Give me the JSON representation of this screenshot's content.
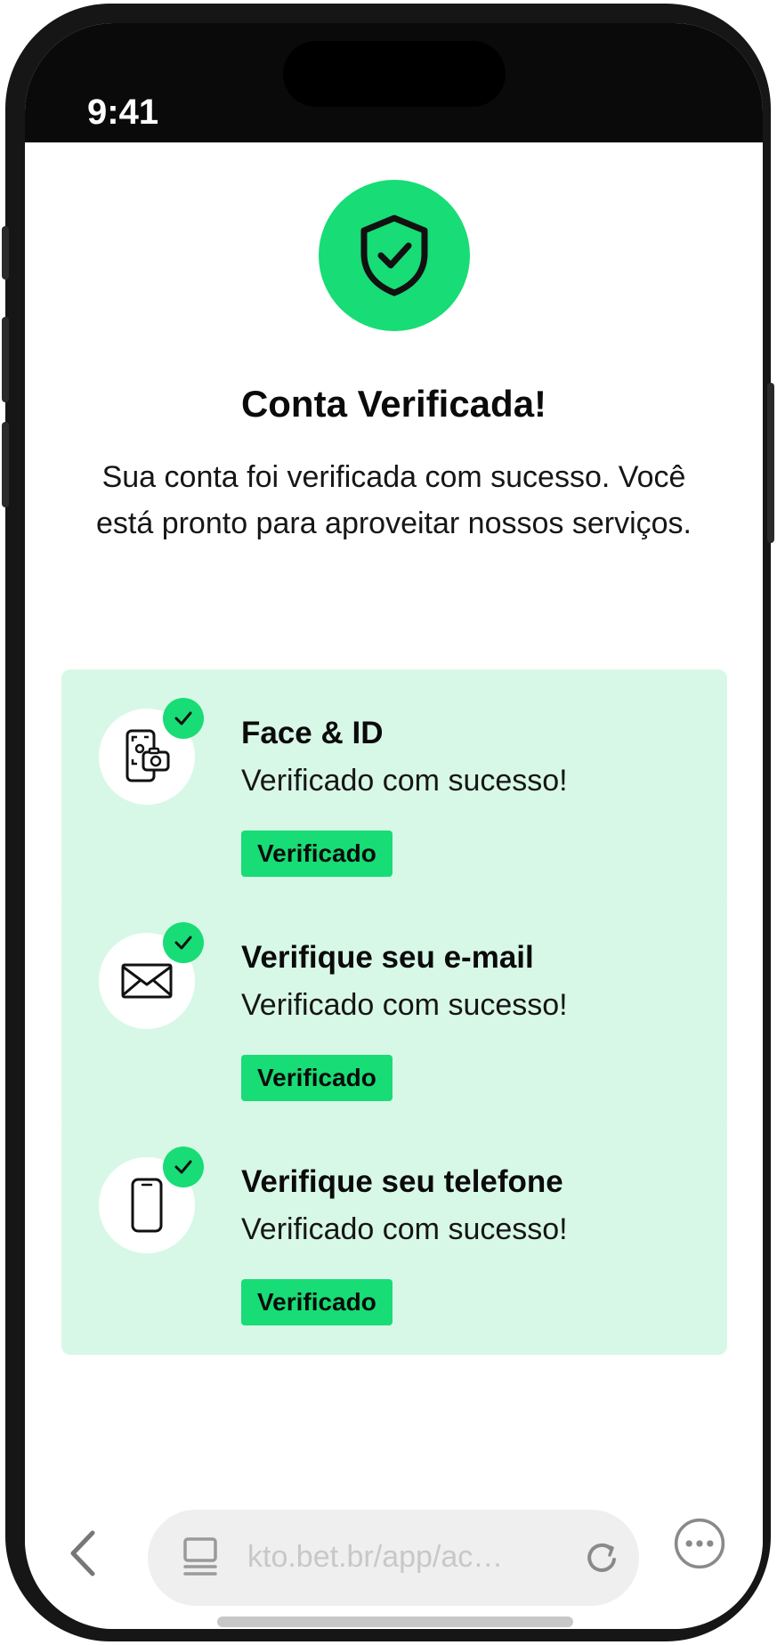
{
  "status_bar": {
    "time": "9:41"
  },
  "header": {
    "icon": "shield-check-icon",
    "title": "Conta Verificada!",
    "description": "Sua conta foi verificada com sucesso. Você está pronto para aproveitar nossos serviços."
  },
  "cards": [
    {
      "icon": "face-id-phone-icon",
      "title": "Face & ID",
      "subtitle": "Verificado com sucesso!",
      "status": "Verificado"
    },
    {
      "icon": "envelope-icon",
      "title": "Verifique seu e-mail",
      "subtitle": "Verificado com sucesso!",
      "status": "Verificado"
    },
    {
      "icon": "phone-icon",
      "title": "Verifique seu telefone",
      "subtitle": "Verificado com sucesso!",
      "status": "Verificado"
    }
  ],
  "browser": {
    "url": "kto.bet.br/app/ac…"
  },
  "colors": {
    "accent": "#18dc75",
    "card_bg": "#d8f8e7"
  }
}
